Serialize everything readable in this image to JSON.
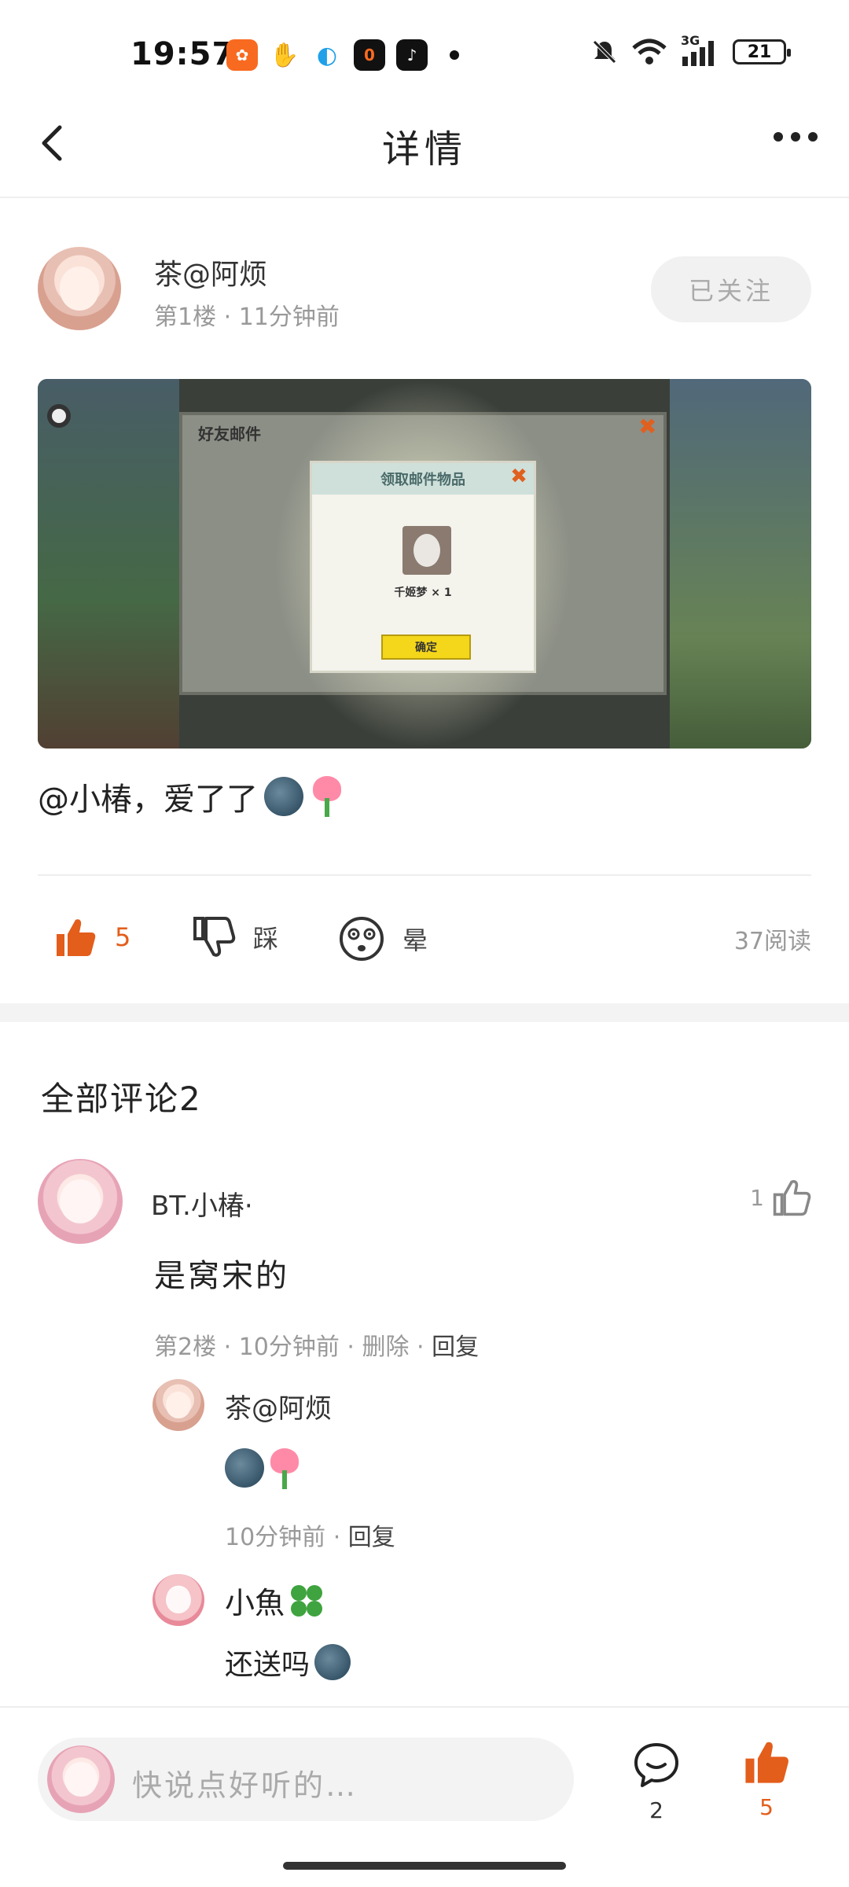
{
  "status_bar": {
    "time": "19:57",
    "network": "3G",
    "battery": "21",
    "app_icons": [
      {
        "name": "kuaishou-icon",
        "color": "#f86a20",
        "glyph": "✿"
      },
      {
        "name": "baidu-icon",
        "color": "#3b7ff0",
        "glyph": "✋"
      },
      {
        "name": "browser-icon",
        "color": "#1fa0e8",
        "glyph": "◐"
      },
      {
        "name": "app-zero-icon",
        "color": "#111111",
        "glyph": "0"
      },
      {
        "name": "tiktok-icon",
        "color": "#111111",
        "glyph": "♪"
      }
    ]
  },
  "nav": {
    "title": "详情"
  },
  "post": {
    "author": "茶@阿烦",
    "meta": "第1楼 · 11分钟前",
    "follow_label": "已关注",
    "text": "@小椿，爱了了",
    "emojis": [
      "new-moon-face",
      "tulip"
    ],
    "image": {
      "mail_title": "好友邮件",
      "dialog_title": "领取邮件物品",
      "item_label": "千姬梦 × 1",
      "confirm_label": "确定"
    }
  },
  "actions": {
    "like_count": "5",
    "dislike_label": "踩",
    "dizzy_label": "晕",
    "read_count": "37阅读"
  },
  "colors": {
    "accent": "#e35d1b"
  },
  "comments": {
    "title": "全部评论2",
    "items": [
      {
        "name": "BT.小椿·",
        "like_count": "1",
        "body": "是窝宋的",
        "meta_time": "第2楼 · 10分钟前 · 删除 · ",
        "reply_label": "回复",
        "replies": [
          {
            "name": "茶@阿烦",
            "meta_time": "10分钟前 · ",
            "reply_label": "回复"
          },
          {
            "name": "小魚",
            "body": "还送吗"
          }
        ]
      }
    ]
  },
  "bottom_bar": {
    "input_placeholder": "快说点好听的…",
    "comment_count": "2",
    "like_count": "5"
  }
}
